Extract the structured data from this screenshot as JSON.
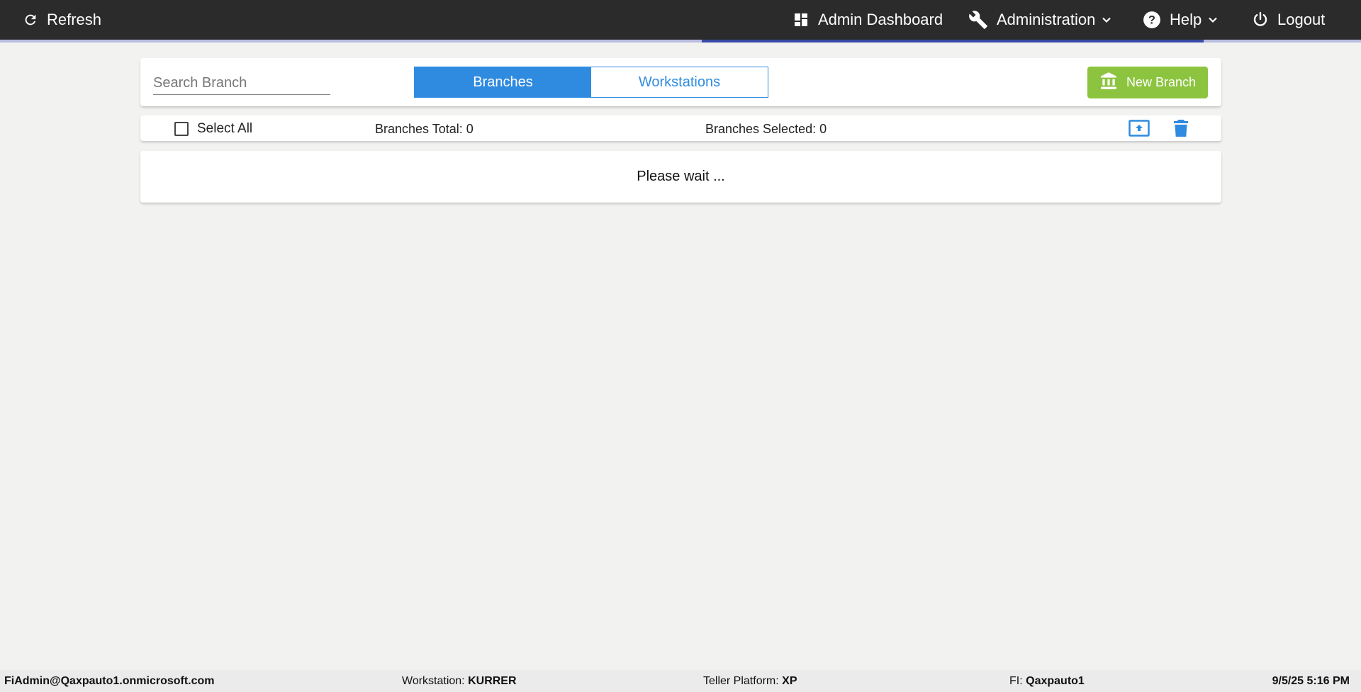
{
  "nav": {
    "refresh": "Refresh",
    "admin_dashboard": "Admin Dashboard",
    "administration": "Administration",
    "help": "Help",
    "logout": "Logout"
  },
  "toolbar": {
    "search_placeholder": "Search Branch",
    "tabs": [
      {
        "label": "Branches",
        "active": true
      },
      {
        "label": "Workstations",
        "active": false
      }
    ],
    "new_branch": "New Branch"
  },
  "selection": {
    "select_all": "Select All",
    "branches_total": "Branches Total: 0",
    "branches_selected": "Branches Selected: 0"
  },
  "message": "Please wait ...",
  "footer": {
    "user": "FiAdmin@Qaxpauto1.onmicrosoft.com",
    "workstation_label": "Workstation:",
    "workstation_value": "KURRER",
    "teller_platform_label": "Teller Platform:",
    "teller_platform_value": "XP",
    "fi_label": "FI:",
    "fi_value": "Qaxpauto1",
    "datetime": "9/5/25 5:16 PM"
  },
  "colors": {
    "navbar": "#2b2b2b",
    "accent_blue": "#2f8be0",
    "new_branch_green": "#8cc43f",
    "progress_bar": "#3a4aa6"
  },
  "icons": [
    "refresh-icon",
    "dashboard-icon",
    "wrench-icon",
    "help-icon",
    "power-icon",
    "bank-icon",
    "upload-icon",
    "trash-icon",
    "chevron-down-icon"
  ]
}
